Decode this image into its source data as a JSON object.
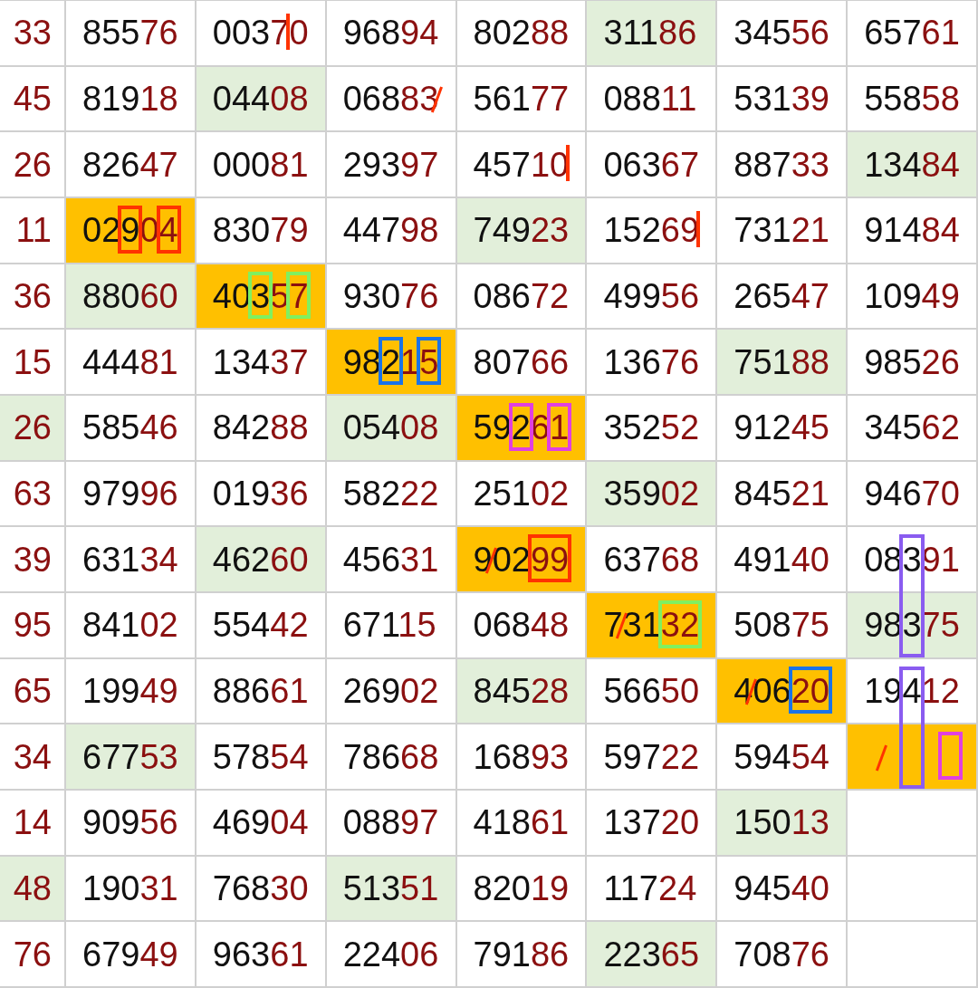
{
  "rows": [
    {
      "cells": [
        {
          "number": "33",
          "color": "#ffffff"
        },
        {
          "number": "85576",
          "color": "#ffffff"
        },
        {
          "number": "00370",
          "color": "#ffffff",
          "marks": {
            "digit_4": {
              "kind": "stroke",
              "color": "#ff3300"
            }
          }
        },
        {
          "number": "96894",
          "color": "#ffffff"
        },
        {
          "number": "80288",
          "color": "#ffffff"
        },
        {
          "number": "31186",
          "color": "#e2efda"
        },
        {
          "number": "34556",
          "color": "#ffffff"
        },
        {
          "number": "65761",
          "color": "#ffffff"
        }
      ]
    },
    {
      "cells": [
        {
          "number": "45",
          "color": "#ffffff"
        },
        {
          "number": "81918",
          "color": "#ffffff"
        },
        {
          "number": "04408",
          "color": "#e2efda"
        },
        {
          "number": "06883",
          "color": "#ffffff",
          "marks": {
            "digit_5": {
              "kind": "slash",
              "color": "#ff3300"
            }
          }
        },
        {
          "number": "56177",
          "color": "#ffffff"
        },
        {
          "number": "08811",
          "color": "#ffffff"
        },
        {
          "number": "53139",
          "color": "#ffffff"
        },
        {
          "number": "55858",
          "color": "#ffffff"
        }
      ]
    },
    {
      "cells": [
        {
          "number": "26",
          "color": "#ffffff"
        },
        {
          "number": "82647",
          "color": "#ffffff"
        },
        {
          "number": "00081",
          "color": "#ffffff"
        },
        {
          "number": "29397",
          "color": "#ffffff"
        },
        {
          "number": "45710",
          "color": "#ffffff",
          "marks": {
            "digit_5": {
              "kind": "stroke",
              "color": "#ff3300"
            }
          }
        },
        {
          "number": "06367",
          "color": "#ffffff"
        },
        {
          "number": "88733",
          "color": "#ffffff"
        },
        {
          "number": "13484",
          "color": "#e2efda"
        }
      ]
    },
    {
      "cells": [
        {
          "number": "11",
          "color": "#ffffff"
        },
        {
          "number": "02904",
          "color": "#ffc000",
          "marks": {
            "digit_3": {
              "kind": "rectangle",
              "color": "#ff3300"
            },
            "digit_5": {
              "kind": "rectangle",
              "color": "#ff3300"
            }
          }
        },
        {
          "number": "83079",
          "color": "#ffffff"
        },
        {
          "number": "44798",
          "color": "#ffffff"
        },
        {
          "number": "74923",
          "color": "#e2efda"
        },
        {
          "number": "15269",
          "color": "#ffffff",
          "marks": {
            "digit_5": {
              "kind": "stroke",
              "color": "#ff3300"
            }
          }
        },
        {
          "number": "73121",
          "color": "#ffffff"
        },
        {
          "number": "91484",
          "color": "#ffffff"
        }
      ]
    },
    {
      "cells": [
        {
          "number": "36",
          "color": "#ffffff"
        },
        {
          "number": "88060",
          "color": "#e2efda"
        },
        {
          "number": "40357",
          "color": "#ffc000",
          "marks": {
            "digit_3": {
              "kind": "rectangle",
              "color": "#80f060"
            },
            "digit_5": {
              "kind": "rectangle",
              "color": "#80f060"
            }
          }
        },
        {
          "number": "93076",
          "color": "#ffffff"
        },
        {
          "number": "08672",
          "color": "#ffffff"
        },
        {
          "number": "49956",
          "color": "#ffffff"
        },
        {
          "number": "26547",
          "color": "#ffffff"
        },
        {
          "number": "10949",
          "color": "#ffffff"
        }
      ]
    },
    {
      "cells": [
        {
          "number": "15",
          "color": "#ffffff"
        },
        {
          "number": "44481",
          "color": "#ffffff"
        },
        {
          "number": "13437",
          "color": "#ffffff"
        },
        {
          "number": "98215",
          "color": "#ffc000",
          "marks": {
            "digit_3": {
              "kind": "rectangle",
              "color": "#1a73e8"
            },
            "digit_5": {
              "kind": "rectangle",
              "color": "#1a73e8"
            }
          }
        },
        {
          "number": "80766",
          "color": "#ffffff"
        },
        {
          "number": "13676",
          "color": "#ffffff"
        },
        {
          "number": "75188",
          "color": "#e2efda"
        },
        {
          "number": "98526",
          "color": "#ffffff"
        }
      ]
    },
    {
      "cells": [
        {
          "number": "26",
          "color": "#e2efda"
        },
        {
          "number": "58546",
          "color": "#ffffff"
        },
        {
          "number": "84288",
          "color": "#ffffff"
        },
        {
          "number": "05408",
          "color": "#e2efda"
        },
        {
          "number": "59261",
          "color": "#ffc000",
          "marks": {
            "digit_3": {
              "kind": "rectangle",
              "color": "#e040e0"
            },
            "digit_5": {
              "kind": "rectangle",
              "color": "#e040e0"
            }
          }
        },
        {
          "number": "35252",
          "color": "#ffffff"
        },
        {
          "number": "91245",
          "color": "#ffffff"
        },
        {
          "number": "34562",
          "color": "#ffffff"
        }
      ]
    },
    {
      "cells": [
        {
          "number": "63",
          "color": "#ffffff"
        },
        {
          "number": "97996",
          "color": "#ffffff"
        },
        {
          "number": "01936",
          "color": "#ffffff"
        },
        {
          "number": "58222",
          "color": "#ffffff"
        },
        {
          "number": "25102",
          "color": "#ffffff"
        },
        {
          "number": "35902",
          "color": "#e2efda"
        },
        {
          "number": "84521",
          "color": "#ffffff"
        },
        {
          "number": "94670",
          "color": "#ffffff"
        }
      ]
    },
    {
      "cells": [
        {
          "number": "39",
          "color": "#ffffff"
        },
        {
          "number": "63134",
          "color": "#ffffff"
        },
        {
          "number": "46260",
          "color": "#e2efda"
        },
        {
          "number": "45631",
          "color": "#ffffff"
        },
        {
          "number": "90299",
          "color": "#ffc000",
          "marks": {
            "digit_1": {
              "kind": "slash",
              "color": "#ff3300"
            },
            "digit_4": {
              "kind": "wide-rectangle",
              "color": "#ff3300"
            }
          }
        },
        {
          "number": "63768",
          "color": "#ffffff"
        },
        {
          "number": "49140",
          "color": "#ffffff"
        },
        {
          "number": "08391",
          "color": "#ffffff",
          "marks": {
            "digit_3": {
              "kind": "tall-rectangle",
              "color": "#8a5cf0"
            }
          }
        }
      ]
    },
    {
      "cells": [
        {
          "number": "95",
          "color": "#ffffff"
        },
        {
          "number": "84102",
          "color": "#ffffff"
        },
        {
          "number": "55442",
          "color": "#ffffff"
        },
        {
          "number": "67115",
          "color": "#ffffff"
        },
        {
          "number": "06848",
          "color": "#ffffff"
        },
        {
          "number": "73132",
          "color": "#ffc000",
          "marks": {
            "digit_1": {
              "kind": "slash",
              "color": "#ff3300"
            },
            "digit_4": {
              "kind": "wide-rectangle",
              "color": "#80f060"
            }
          }
        },
        {
          "number": "50875",
          "color": "#ffffff"
        },
        {
          "number": "98375",
          "color": "#e2efda"
        }
      ]
    },
    {
      "cells": [
        {
          "number": "65",
          "color": "#ffffff"
        },
        {
          "number": "19949",
          "color": "#ffffff"
        },
        {
          "number": "88661",
          "color": "#ffffff"
        },
        {
          "number": "26902",
          "color": "#ffffff"
        },
        {
          "number": "84528",
          "color": "#e2efda"
        },
        {
          "number": "56650",
          "color": "#ffffff"
        },
        {
          "number": "40620",
          "color": "#ffc000",
          "marks": {
            "digit_1": {
              "kind": "slash",
              "color": "#ff3300"
            },
            "digit_4": {
              "kind": "wide-rectangle",
              "color": "#1a73e8"
            }
          }
        },
        {
          "number": "19412",
          "color": "#ffffff",
          "marks": {
            "digit_3": {
              "kind": "tall-rectangle",
              "color": "#8a5cf0"
            }
          }
        }
      ]
    },
    {
      "cells": [
        {
          "number": "34",
          "color": "#ffffff"
        },
        {
          "number": "67753",
          "color": "#e2efda"
        },
        {
          "number": "57854",
          "color": "#ffffff"
        },
        {
          "number": "78668",
          "color": "#ffffff"
        },
        {
          "number": "16893",
          "color": "#ffffff"
        },
        {
          "number": "59722",
          "color": "#ffffff"
        },
        {
          "number": "59454",
          "color": "#ffffff"
        },
        {
          "color": "#ffc000",
          "marks": {
            "digit_1": {
              "kind": "slash",
              "color": "#ff3300"
            },
            "digit_5": {
              "kind": "rectangle",
              "color": "#e040e0"
            }
          }
        }
      ]
    },
    {
      "cells": [
        {
          "number": "14",
          "color": "#ffffff"
        },
        {
          "number": "90956",
          "color": "#ffffff"
        },
        {
          "number": "46904",
          "color": "#ffffff"
        },
        {
          "number": "08897",
          "color": "#ffffff"
        },
        {
          "number": "41861",
          "color": "#ffffff"
        },
        {
          "number": "13720",
          "color": "#ffffff"
        },
        {
          "number": "15013",
          "color": "#e2efda"
        },
        {
          "color": "#ffffff"
        }
      ]
    },
    {
      "cells": [
        {
          "number": "48",
          "color": "#e2efda"
        },
        {
          "number": "19031",
          "color": "#ffffff"
        },
        {
          "number": "76830",
          "color": "#ffffff"
        },
        {
          "number": "51351",
          "color": "#e2efda"
        },
        {
          "number": "82019",
          "color": "#ffffff"
        },
        {
          "number": "11724",
          "color": "#ffffff"
        },
        {
          "number": "94540",
          "color": "#ffffff"
        },
        {
          "color": "#ffffff"
        }
      ]
    },
    {
      "cells": [
        {
          "number": "76",
          "color": "#ffffff"
        },
        {
          "number": "67949",
          "color": "#ffffff"
        },
        {
          "number": "96361",
          "color": "#ffffff"
        },
        {
          "number": "22406",
          "color": "#ffffff"
        },
        {
          "number": "79186",
          "color": "#ffffff"
        },
        {
          "number": "22365",
          "color": "#e2efda"
        },
        {
          "number": "70876",
          "color": "#ffffff"
        },
        {
          "color": "#ffffff"
        }
      ]
    }
  ]
}
